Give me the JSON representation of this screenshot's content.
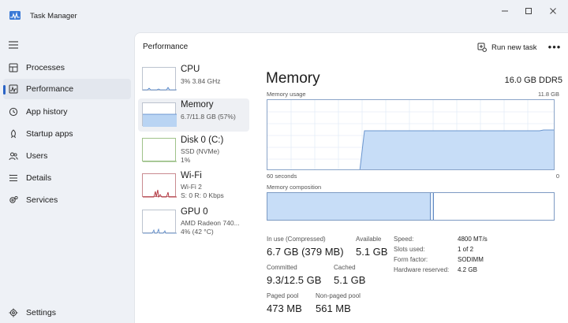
{
  "app": {
    "title": "Task Manager"
  },
  "sidebar": {
    "items": [
      {
        "label": "Processes",
        "icon": "processes-icon"
      },
      {
        "label": "Performance",
        "icon": "performance-icon",
        "active": true
      },
      {
        "label": "App history",
        "icon": "history-icon"
      },
      {
        "label": "Startup apps",
        "icon": "startup-icon"
      },
      {
        "label": "Users",
        "icon": "users-icon"
      },
      {
        "label": "Details",
        "icon": "details-icon"
      },
      {
        "label": "Services",
        "icon": "services-icon"
      }
    ],
    "settings_label": "Settings"
  },
  "header": {
    "title": "Performance",
    "run_new_task": "Run new task"
  },
  "devices": [
    {
      "name": "CPU",
      "sub1": "3% 3.84 GHz"
    },
    {
      "name": "Memory",
      "sub1": "6.7/11.8 GB (57%)",
      "selected": true
    },
    {
      "name": "Disk 0 (C:)",
      "sub1": "SSD (NVMe)",
      "sub2": "1%"
    },
    {
      "name": "Wi-Fi",
      "sub1": "Wi-Fi 2",
      "sub2": "S: 0 R: 0 Kbps"
    },
    {
      "name": "GPU 0",
      "sub1": "AMD Radeon 740...",
      "sub2": "4% (42 °C)"
    }
  ],
  "memory": {
    "title": "Memory",
    "total": "16.0 GB DDR5",
    "usage_label": "Memory usage",
    "usage_max": "11.8 GB",
    "time_span": "60 seconds",
    "time_end": "0",
    "composition_label": "Memory composition",
    "usage_level": 0.57,
    "in_use_label": "In use (Compressed)",
    "in_use_value": "6.7 GB (379 MB)",
    "available_label": "Available",
    "available_value": "5.1 GB",
    "committed_label": "Committed",
    "committed_value": "9.3/12.5 GB",
    "cached_label": "Cached",
    "cached_value": "5.1 GB",
    "paged_label": "Paged pool",
    "paged_value": "473 MB",
    "nonpaged_label": "Non-paged pool",
    "nonpaged_value": "561 MB",
    "details": [
      {
        "label": "Speed:",
        "value": "4800 MT/s"
      },
      {
        "label": "Slots used:",
        "value": "1 of 2"
      },
      {
        "label": "Form factor:",
        "value": "SODIMM"
      },
      {
        "label": "Hardware reserved:",
        "value": "4.2 GB"
      }
    ]
  },
  "colors": {
    "accent": "#2a63c5",
    "memory_fill": "#c7ddf7",
    "memory_line": "#6a95cf",
    "wifi": "#b0303a"
  }
}
